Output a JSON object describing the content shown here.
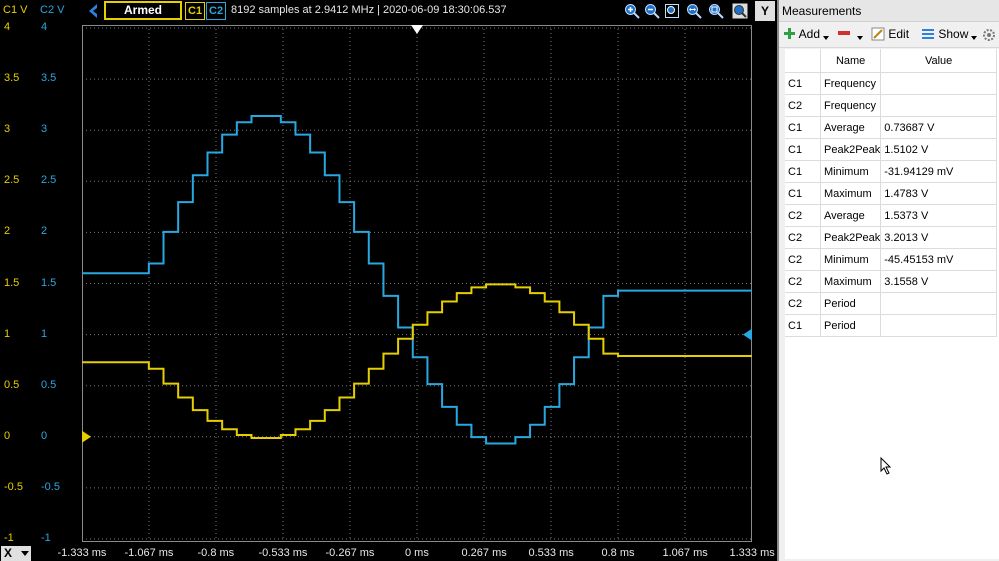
{
  "topbar": {
    "c1_header": "C1 V",
    "c2_header": "C2 V",
    "status": "Armed",
    "c1_tag": "C1",
    "c2_tag": "C2",
    "acquisition": "8192 samples at 2.9412 MHz | 2020-06-09 18:30:06.537",
    "y_button": "Y",
    "icons": [
      "zoom-in-icon",
      "zoom-out-icon",
      "zoom-box-icon",
      "zoom-horizontal-icon",
      "zoom-fit-icon",
      "zoom-reset-icon",
      "settings-icon"
    ]
  },
  "y_axis": {
    "c1_labels": [
      "4",
      "3.5",
      "3",
      "2.5",
      "2",
      "1.5",
      "1",
      "0.5",
      "0",
      "-0.5",
      "-1"
    ],
    "c2_labels": [
      "4",
      "3.5",
      "3",
      "2.5",
      "2",
      "1.5",
      "1",
      "0.5",
      "0",
      "-0.5",
      "-1"
    ],
    "range": [
      -1,
      4
    ]
  },
  "x_axis": {
    "button": "X",
    "labels": [
      "-1.333 ms",
      "-1.067 ms",
      "-0.8 ms",
      "-0.533 ms",
      "-0.267 ms",
      "0 ms",
      "0.267 ms",
      "0.533 ms",
      "0.8 ms",
      "1.067 ms",
      "1.333 ms"
    ],
    "range_ms": [
      -1.333,
      1.333
    ]
  },
  "colors": {
    "c1": "#e6cf00",
    "c2": "#29a8e0",
    "grid": "#7a7a7a"
  },
  "chart_data": {
    "type": "line",
    "x_unit": "ms",
    "y_unit": "V",
    "xlim": [
      -1.333,
      1.333
    ],
    "ylim": [
      -1,
      4
    ],
    "grid": true,
    "series": [
      {
        "name": "C1",
        "color": "#e6cf00",
        "steps": 32,
        "pre_level": 0.73,
        "post_level": 0.79,
        "t_start": -1.067,
        "t_end": 0.8,
        "offset": 0.74,
        "amplitude": -0.755,
        "phase": "cos"
      },
      {
        "name": "C2",
        "color": "#29a8e0",
        "steps": 32,
        "pre_level": 1.6,
        "post_level": 1.43,
        "t_start": -1.067,
        "t_end": 0.8,
        "offset": 1.5373,
        "amplitude": 1.61,
        "phase": "cos_neg"
      }
    ]
  },
  "panel": {
    "title": "Measurements",
    "tools": {
      "add": "Add",
      "remove": "",
      "edit": "Edit",
      "show": "Show"
    },
    "headers": [
      "",
      "Name",
      "Value"
    ],
    "rows": [
      [
        "C1",
        "Frequency",
        ""
      ],
      [
        "C2",
        "Frequency",
        ""
      ],
      [
        "C1",
        "Average",
        "0.73687 V"
      ],
      [
        "C1",
        "Peak2Peak",
        "1.5102 V"
      ],
      [
        "C1",
        "Minimum",
        "-31.94129 mV"
      ],
      [
        "C1",
        "Maximum",
        "1.4783 V"
      ],
      [
        "C2",
        "Average",
        "1.5373 V"
      ],
      [
        "C2",
        "Peak2Peak",
        "3.2013 V"
      ],
      [
        "C2",
        "Minimum",
        "-45.45153 mV"
      ],
      [
        "C2",
        "Maximum",
        "3.1558 V"
      ],
      [
        "C2",
        "Period",
        ""
      ],
      [
        "C1",
        "Period",
        ""
      ]
    ]
  }
}
